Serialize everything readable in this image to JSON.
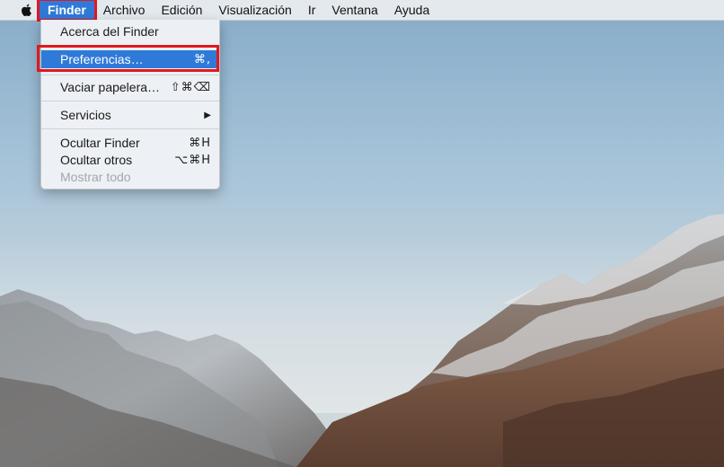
{
  "menubar": {
    "apple_icon": "apple-icon",
    "items": [
      {
        "label": "Finder",
        "active": true
      },
      {
        "label": "Archivo"
      },
      {
        "label": "Edición"
      },
      {
        "label": "Visualización"
      },
      {
        "label": "Ir"
      },
      {
        "label": "Ventana"
      },
      {
        "label": "Ayuda"
      }
    ]
  },
  "finder_menu": {
    "about": {
      "label": "Acerca del Finder"
    },
    "preferences": {
      "label": "Preferencias…",
      "shortcut": "⌘,",
      "highlighted": true
    },
    "empty_trash": {
      "label": "Vaciar papelera…",
      "shortcut": "⇧⌘⌫"
    },
    "services": {
      "label": "Servicios",
      "submenu_icon": "triangle-right-icon"
    },
    "hide_finder": {
      "label": "Ocultar Finder",
      "shortcut": "⌘H"
    },
    "hide_others": {
      "label": "Ocultar otros",
      "shortcut": "⌥⌘H"
    },
    "show_all": {
      "label": "Mostrar todo",
      "disabled": true
    }
  },
  "colors": {
    "highlight": "#2f7ad8",
    "annotation_red": "#e0181f"
  }
}
